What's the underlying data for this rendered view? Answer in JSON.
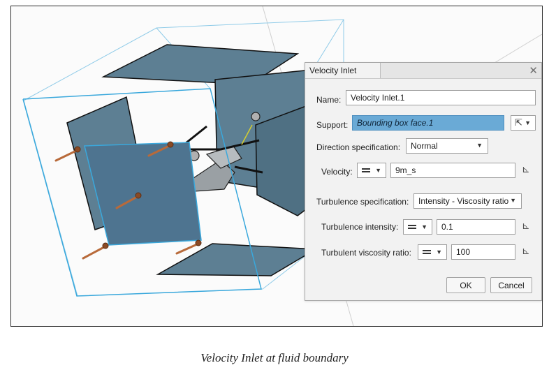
{
  "dialog": {
    "title": "Velocity Inlet",
    "close_glyph": "✕",
    "name_label": "Name:",
    "name_value": "Velocity Inlet.1",
    "support_label": "Support:",
    "support_value": "Bounding box face.1",
    "support_select_icon": "cursor-arrow-icon",
    "direction_label": "Direction specification:",
    "direction_value": "Normal",
    "velocity_label": "Velocity:",
    "velocity_value": "9m_s",
    "turbulence_spec_label": "Turbulence specification:",
    "turbulence_spec_value": "Intensity - Viscosity ratio",
    "turbulence_intensity_label": "Turbulence intensity:",
    "turbulence_intensity_value": "0.1",
    "turbulent_viscosity_label": "Turbulent viscosity ratio:",
    "turbulent_viscosity_value": "100",
    "ok_label": "OK",
    "cancel_label": "Cancel",
    "unit_icon": "unit-axis-icon"
  },
  "caption": "Velocity Inlet at fluid boundary",
  "colors": {
    "panel_fill": "#5d7f93",
    "box_highlight": "#3aa8dc",
    "support_field": "#6aaad6",
    "arrow": "#b86a3a"
  }
}
